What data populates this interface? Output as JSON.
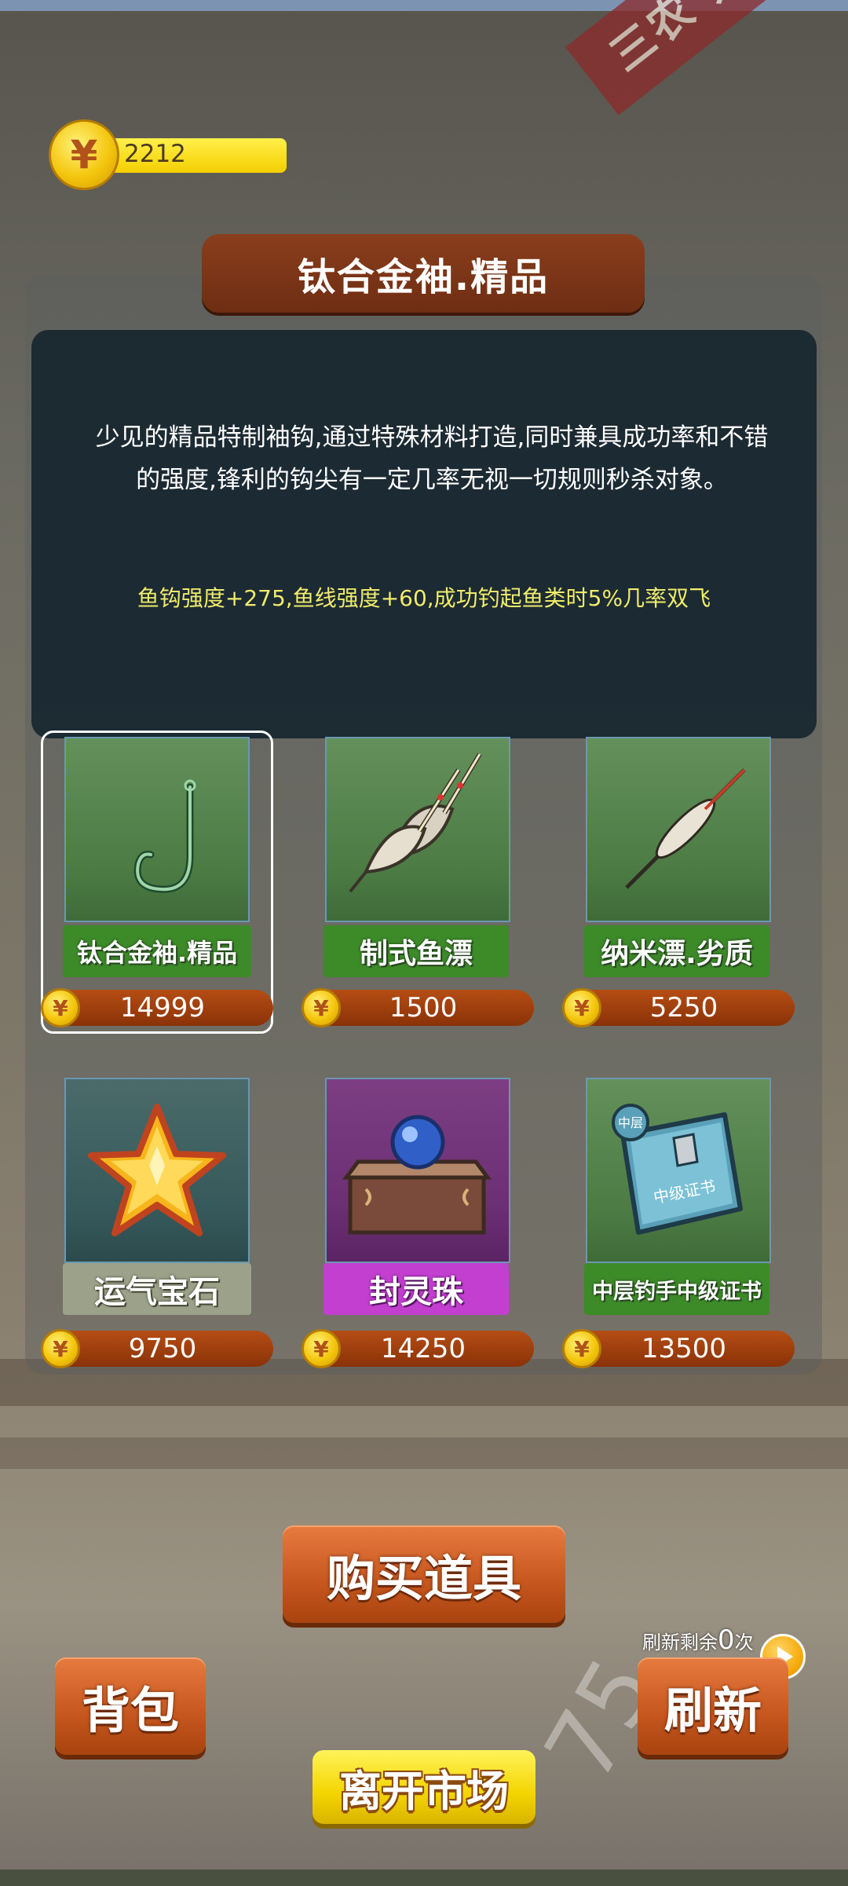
{
  "currency": {
    "icon": "yuan-coin-icon",
    "amount": "2212"
  },
  "selected_item": {
    "title": "钛合金袖.精品",
    "description": "少见的精品特制袖钩,通过特殊材料打造,同时兼具成功率和不错的强度,锋利的钩尖有一定几率无视一切规则秒杀对象。",
    "effect": "鱼钩强度+275,鱼线强度+60,成功钓起鱼类时5%几率双飞"
  },
  "items": [
    {
      "name": "钛合金袖.精品",
      "price": "14999",
      "icon": "fish-hook-icon"
    },
    {
      "name": "制式鱼漂",
      "price": "1500",
      "icon": "fishing-float-pair-icon"
    },
    {
      "name": "纳米漂.劣质",
      "price": "5250",
      "icon": "nano-float-icon"
    },
    {
      "name": "运气宝石",
      "price": "9750",
      "icon": "star-gem-icon"
    },
    {
      "name": "封灵珠",
      "price": "14250",
      "icon": "treasure-box-orb-icon"
    },
    {
      "name": "中层钓手中级证书",
      "price": "13500",
      "icon": "certificate-book-icon"
    }
  ],
  "certificate_cover": {
    "badge": "中层",
    "title": "中级证书"
  },
  "buttons": {
    "buy": "购买道具",
    "bag": "背包",
    "refresh": "刷新",
    "leave": "离开市场"
  },
  "refresh_info": {
    "prefix": "刷新剩余",
    "count": "0",
    "suffix": "次"
  },
  "background": {
    "banner_text": "三农 共同富",
    "road_mark": "75"
  }
}
